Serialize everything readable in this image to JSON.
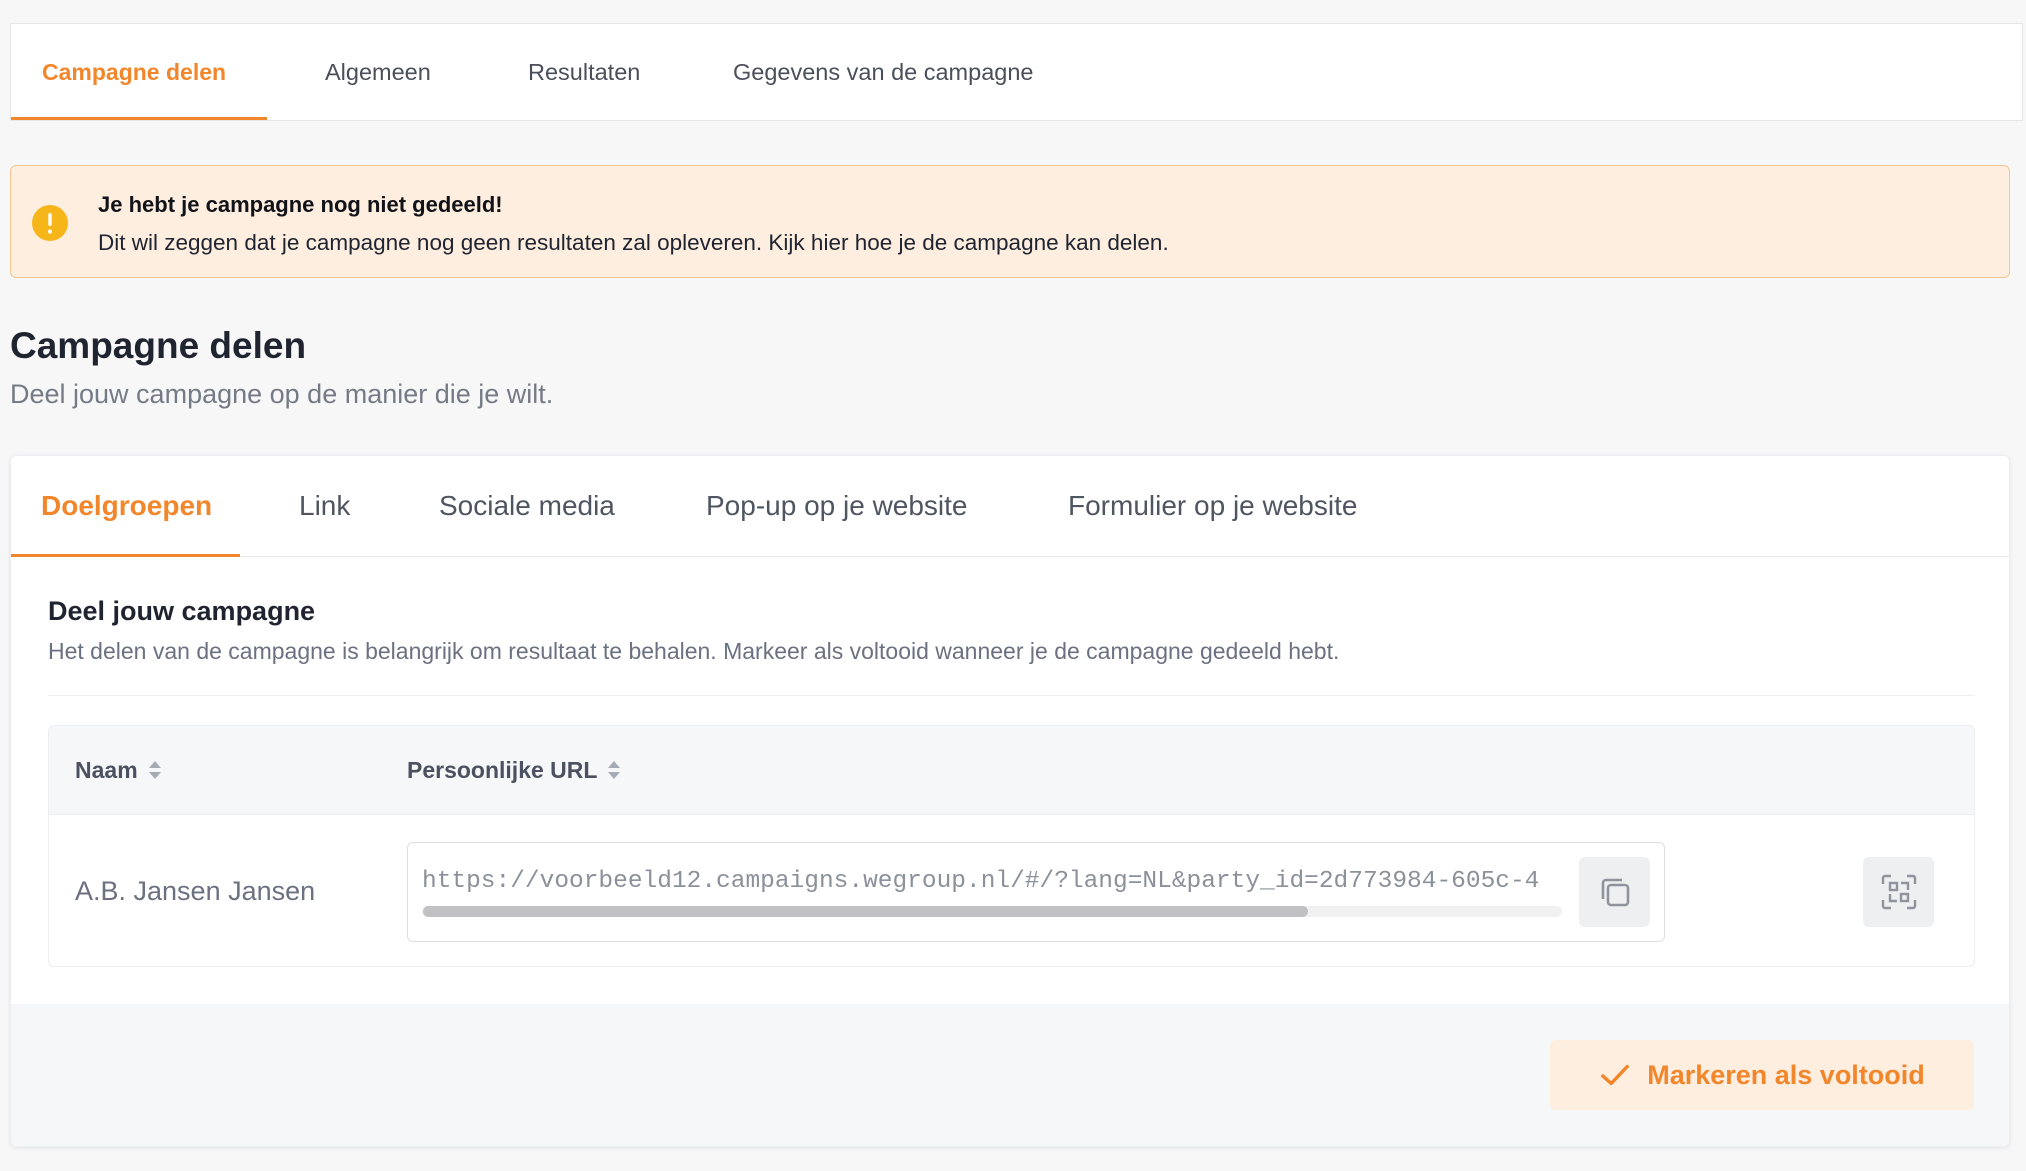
{
  "colors": {
    "accent": "#f2862b",
    "alert_background": "#fdeee0",
    "alert_border": "#f5c591",
    "warning_icon": "#f6b619"
  },
  "top_tabs": [
    {
      "label": "Campagne delen",
      "active": true
    },
    {
      "label": "Algemeen",
      "active": false
    },
    {
      "label": "Resultaten",
      "active": false
    },
    {
      "label": "Gegevens van de campagne",
      "active": false
    }
  ],
  "alert": {
    "icon": "warning-icon",
    "title": "Je hebt je campagne nog niet gedeeld!",
    "message": "Dit wil zeggen dat je campagne nog geen resultaten zal opleveren. Kijk hier hoe je de campagne kan delen."
  },
  "section": {
    "title": "Campagne delen",
    "subtitle": "Deel jouw campagne op de manier die je wilt."
  },
  "share_tabs": [
    {
      "label": "Doelgroepen",
      "active": true
    },
    {
      "label": "Link",
      "active": false
    },
    {
      "label": "Sociale media",
      "active": false
    },
    {
      "label": "Pop-up op je website",
      "active": false
    },
    {
      "label": "Formulier op je website",
      "active": false
    }
  ],
  "panel": {
    "title": "Deel jouw campagne",
    "description": "Het delen van de campagne is belangrijk om resultaat te behalen. Markeer als voltooid wanneer je de campagne gedeeld hebt."
  },
  "table": {
    "columns": [
      {
        "label": "Naam",
        "sort_icon": "sort-icon"
      },
      {
        "label": "Persoonlijke URL",
        "sort_icon": "sort-icon"
      }
    ],
    "rows": [
      {
        "name": "A.B. Jansen Jansen",
        "url": "https://voorbeeld12.campaigns.wegroup.nl/#/?lang=NL&party_id=2d773984-605c-4",
        "copy_icon": "copy-icon",
        "qr_icon": "qr-code-icon"
      }
    ]
  },
  "footer": {
    "complete_label": "Markeren als voltooid",
    "complete_icon": "check-icon"
  }
}
